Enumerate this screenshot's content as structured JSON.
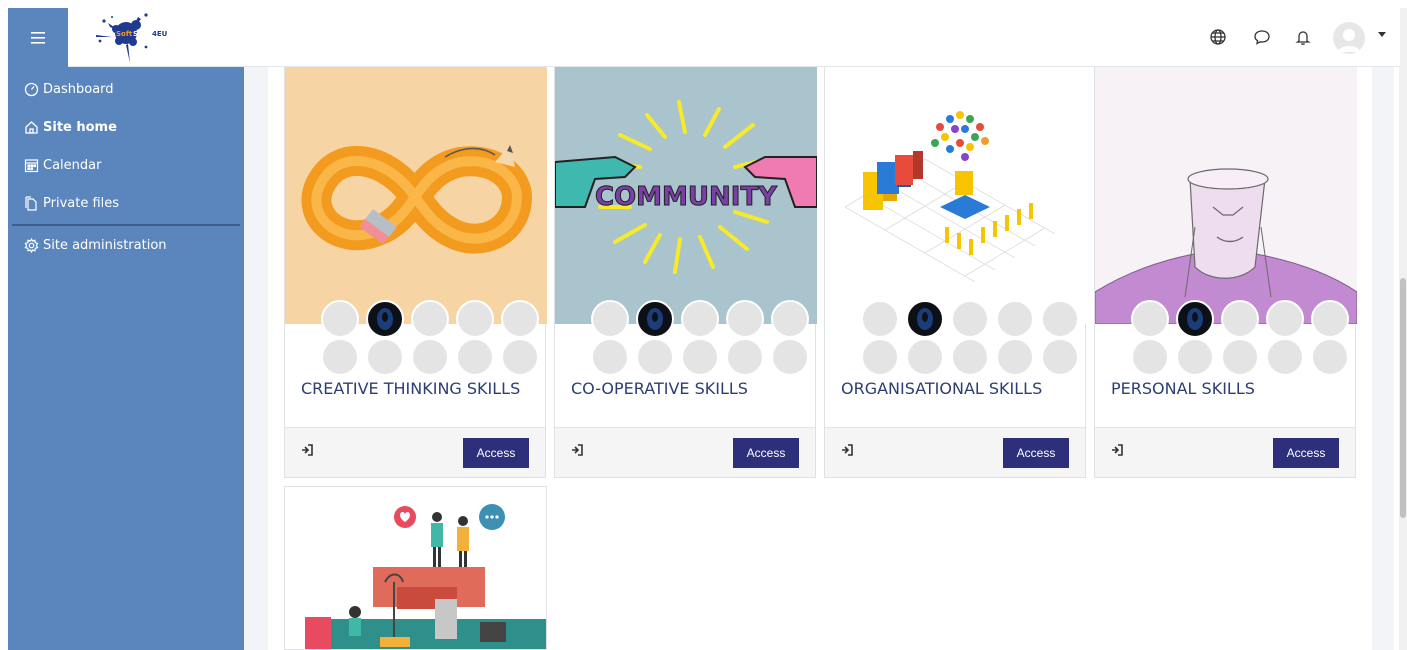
{
  "site": {
    "logo_text": "SoftSkills4EU"
  },
  "navbar": {
    "menu_icon": "hamburger-icon",
    "icons": [
      "globe-icon",
      "chat-icon",
      "bell-icon"
    ]
  },
  "sidebar": {
    "items": [
      {
        "label": "Dashboard",
        "icon": "gauge-icon"
      },
      {
        "label": "Site home",
        "icon": "home-icon"
      },
      {
        "label": "Calendar",
        "icon": "calendar-icon"
      },
      {
        "label": "Private files",
        "icon": "files-icon"
      },
      {
        "label": "Site administration",
        "icon": "gear-icon"
      }
    ]
  },
  "courses": [
    {
      "title": "CREATIVE THINKING SKILLS",
      "button": "Access",
      "bg": "#f7d4a4"
    },
    {
      "title": "CO-OPERATIVE SKILLS",
      "button": "Access",
      "bg": "#a9c4cc"
    },
    {
      "title": "ORGANISATIONAL SKILLS",
      "button": "Access",
      "bg": "#ffffff"
    },
    {
      "title": "PERSONAL SKILLS",
      "button": "Access",
      "bg": "#f6f2f6"
    },
    {
      "title": "",
      "button": "",
      "bg": "#ffffff"
    }
  ],
  "community_word": "COMMUNITY",
  "colors": {
    "sidebar": "#5b86bd",
    "accent": "#2d2f7a",
    "title": "#2c3e74"
  }
}
